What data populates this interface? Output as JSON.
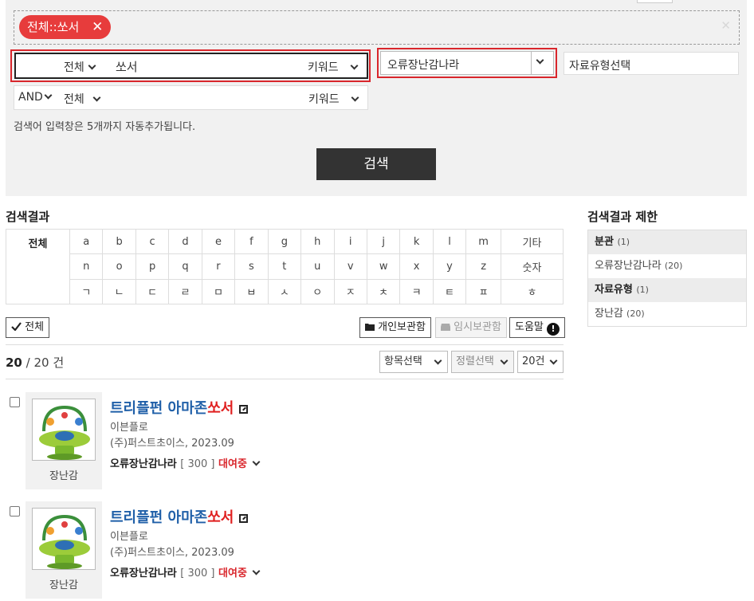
{
  "filter": {
    "tag_label": "전체::쏘서",
    "tag_close": "✕",
    "clear": "✕"
  },
  "search_rows": [
    {
      "field": "전체",
      "query": "쏘서",
      "mode": "키워드"
    },
    {
      "op": "AND",
      "field": "전체",
      "query": "",
      "mode": "키워드"
    }
  ],
  "library_select": "오류장난감나라",
  "type_select": "자료유형선택",
  "hint": "검색어 입력창은 5개까지 자동추가됩니다.",
  "search_button": "검색",
  "results_title": "검색결과",
  "alpha": {
    "all_label": "전체",
    "row1": [
      "a",
      "b",
      "c",
      "d",
      "e",
      "f",
      "g",
      "h",
      "i",
      "j",
      "k",
      "l",
      "m"
    ],
    "row1_end": "기타",
    "row2": [
      "n",
      "o",
      "p",
      "q",
      "r",
      "s",
      "t",
      "u",
      "v",
      "w",
      "x",
      "y",
      "z"
    ],
    "row2_end": "숫자",
    "row3": [
      "ㄱ",
      "ㄴ",
      "ㄷ",
      "ㄹ",
      "ㅁ",
      "ㅂ",
      "ㅅ",
      "ㅇ",
      "ㅈ",
      "ㅊ",
      "ㅋ",
      "ㅌ",
      "ㅍ"
    ],
    "row3_end": "ㅎ"
  },
  "actions": {
    "select_all": "전체",
    "personal_archive": "개인보관함",
    "temp_archive": "임시보관함",
    "help": "도움말",
    "help_icon": "!"
  },
  "count": {
    "shown": "20",
    "total": "/ 20 건"
  },
  "dropdowns": {
    "items": "항목선택",
    "sort": "정렬선택",
    "per_page": "20건"
  },
  "results": [
    {
      "title_pre": "트리플펀 아마존",
      "title_hl": "쏘서",
      "author": "이븐플로",
      "publisher": "(주)퍼스트초이스, 2023.09",
      "library": "오류장난감나라",
      "call_no": "[ 300 ]",
      "status": "대여중",
      "type": "장난감"
    },
    {
      "title_pre": "트리플펀 아마존",
      "title_hl": "쏘서",
      "author": "이븐플로",
      "publisher": "(주)퍼스트초이스, 2023.09",
      "library": "오류장난감나라",
      "call_no": "[ 300 ]",
      "status": "대여중",
      "type": "장난감"
    }
  ],
  "side": {
    "title": "검색결과 제한",
    "branch_head": "분관",
    "branch_count": "(1)",
    "branch_item": "오류장난감나라",
    "branch_item_count": "(20)",
    "type_head": "자료유형",
    "type_count": "(1)",
    "type_item": "장난감",
    "type_item_count": "(20)"
  }
}
